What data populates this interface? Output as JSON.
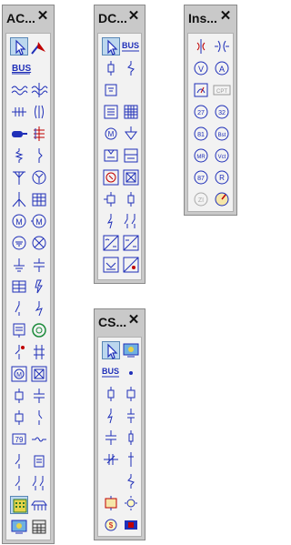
{
  "ac": {
    "title": "AC...",
    "close": "✕",
    "bus": "BUS"
  },
  "dc": {
    "title": "DC...",
    "close": "✕",
    "bus": "BUS"
  },
  "ins": {
    "title": "Ins...",
    "close": "✕",
    "labels": [
      "CPT",
      "27",
      "32",
      "81",
      "Bst",
      "Vct",
      "MR",
      "87",
      "R",
      "ZI"
    ]
  },
  "cs": {
    "title": "CS...",
    "close": "✕",
    "bus": "BUS"
  },
  "colors": {
    "palette_bg": "#c9c9c9",
    "body_bg": "#f2f2f2",
    "symbol_blue": "#1f2fb8",
    "selected": "#bcd7ee"
  }
}
